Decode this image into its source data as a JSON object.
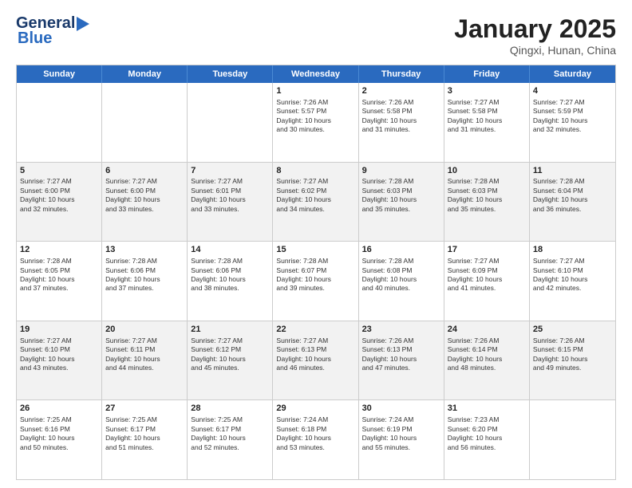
{
  "header": {
    "logo_line1": "General",
    "logo_line2": "Blue",
    "title": "January 2025",
    "subtitle": "Qingxi, Hunan, China"
  },
  "weekdays": [
    "Sunday",
    "Monday",
    "Tuesday",
    "Wednesday",
    "Thursday",
    "Friday",
    "Saturday"
  ],
  "rows": [
    {
      "alt": false,
      "cells": [
        {
          "day": "",
          "lines": []
        },
        {
          "day": "",
          "lines": []
        },
        {
          "day": "",
          "lines": []
        },
        {
          "day": "1",
          "lines": [
            "Sunrise: 7:26 AM",
            "Sunset: 5:57 PM",
            "Daylight: 10 hours",
            "and 30 minutes."
          ]
        },
        {
          "day": "2",
          "lines": [
            "Sunrise: 7:26 AM",
            "Sunset: 5:58 PM",
            "Daylight: 10 hours",
            "and 31 minutes."
          ]
        },
        {
          "day": "3",
          "lines": [
            "Sunrise: 7:27 AM",
            "Sunset: 5:58 PM",
            "Daylight: 10 hours",
            "and 31 minutes."
          ]
        },
        {
          "day": "4",
          "lines": [
            "Sunrise: 7:27 AM",
            "Sunset: 5:59 PM",
            "Daylight: 10 hours",
            "and 32 minutes."
          ]
        }
      ]
    },
    {
      "alt": true,
      "cells": [
        {
          "day": "5",
          "lines": [
            "Sunrise: 7:27 AM",
            "Sunset: 6:00 PM",
            "Daylight: 10 hours",
            "and 32 minutes."
          ]
        },
        {
          "day": "6",
          "lines": [
            "Sunrise: 7:27 AM",
            "Sunset: 6:00 PM",
            "Daylight: 10 hours",
            "and 33 minutes."
          ]
        },
        {
          "day": "7",
          "lines": [
            "Sunrise: 7:27 AM",
            "Sunset: 6:01 PM",
            "Daylight: 10 hours",
            "and 33 minutes."
          ]
        },
        {
          "day": "8",
          "lines": [
            "Sunrise: 7:27 AM",
            "Sunset: 6:02 PM",
            "Daylight: 10 hours",
            "and 34 minutes."
          ]
        },
        {
          "day": "9",
          "lines": [
            "Sunrise: 7:28 AM",
            "Sunset: 6:03 PM",
            "Daylight: 10 hours",
            "and 35 minutes."
          ]
        },
        {
          "day": "10",
          "lines": [
            "Sunrise: 7:28 AM",
            "Sunset: 6:03 PM",
            "Daylight: 10 hours",
            "and 35 minutes."
          ]
        },
        {
          "day": "11",
          "lines": [
            "Sunrise: 7:28 AM",
            "Sunset: 6:04 PM",
            "Daylight: 10 hours",
            "and 36 minutes."
          ]
        }
      ]
    },
    {
      "alt": false,
      "cells": [
        {
          "day": "12",
          "lines": [
            "Sunrise: 7:28 AM",
            "Sunset: 6:05 PM",
            "Daylight: 10 hours",
            "and 37 minutes."
          ]
        },
        {
          "day": "13",
          "lines": [
            "Sunrise: 7:28 AM",
            "Sunset: 6:06 PM",
            "Daylight: 10 hours",
            "and 37 minutes."
          ]
        },
        {
          "day": "14",
          "lines": [
            "Sunrise: 7:28 AM",
            "Sunset: 6:06 PM",
            "Daylight: 10 hours",
            "and 38 minutes."
          ]
        },
        {
          "day": "15",
          "lines": [
            "Sunrise: 7:28 AM",
            "Sunset: 6:07 PM",
            "Daylight: 10 hours",
            "and 39 minutes."
          ]
        },
        {
          "day": "16",
          "lines": [
            "Sunrise: 7:28 AM",
            "Sunset: 6:08 PM",
            "Daylight: 10 hours",
            "and 40 minutes."
          ]
        },
        {
          "day": "17",
          "lines": [
            "Sunrise: 7:27 AM",
            "Sunset: 6:09 PM",
            "Daylight: 10 hours",
            "and 41 minutes."
          ]
        },
        {
          "day": "18",
          "lines": [
            "Sunrise: 7:27 AM",
            "Sunset: 6:10 PM",
            "Daylight: 10 hours",
            "and 42 minutes."
          ]
        }
      ]
    },
    {
      "alt": true,
      "cells": [
        {
          "day": "19",
          "lines": [
            "Sunrise: 7:27 AM",
            "Sunset: 6:10 PM",
            "Daylight: 10 hours",
            "and 43 minutes."
          ]
        },
        {
          "day": "20",
          "lines": [
            "Sunrise: 7:27 AM",
            "Sunset: 6:11 PM",
            "Daylight: 10 hours",
            "and 44 minutes."
          ]
        },
        {
          "day": "21",
          "lines": [
            "Sunrise: 7:27 AM",
            "Sunset: 6:12 PM",
            "Daylight: 10 hours",
            "and 45 minutes."
          ]
        },
        {
          "day": "22",
          "lines": [
            "Sunrise: 7:27 AM",
            "Sunset: 6:13 PM",
            "Daylight: 10 hours",
            "and 46 minutes."
          ]
        },
        {
          "day": "23",
          "lines": [
            "Sunrise: 7:26 AM",
            "Sunset: 6:13 PM",
            "Daylight: 10 hours",
            "and 47 minutes."
          ]
        },
        {
          "day": "24",
          "lines": [
            "Sunrise: 7:26 AM",
            "Sunset: 6:14 PM",
            "Daylight: 10 hours",
            "and 48 minutes."
          ]
        },
        {
          "day": "25",
          "lines": [
            "Sunrise: 7:26 AM",
            "Sunset: 6:15 PM",
            "Daylight: 10 hours",
            "and 49 minutes."
          ]
        }
      ]
    },
    {
      "alt": false,
      "cells": [
        {
          "day": "26",
          "lines": [
            "Sunrise: 7:25 AM",
            "Sunset: 6:16 PM",
            "Daylight: 10 hours",
            "and 50 minutes."
          ]
        },
        {
          "day": "27",
          "lines": [
            "Sunrise: 7:25 AM",
            "Sunset: 6:17 PM",
            "Daylight: 10 hours",
            "and 51 minutes."
          ]
        },
        {
          "day": "28",
          "lines": [
            "Sunrise: 7:25 AM",
            "Sunset: 6:17 PM",
            "Daylight: 10 hours",
            "and 52 minutes."
          ]
        },
        {
          "day": "29",
          "lines": [
            "Sunrise: 7:24 AM",
            "Sunset: 6:18 PM",
            "Daylight: 10 hours",
            "and 53 minutes."
          ]
        },
        {
          "day": "30",
          "lines": [
            "Sunrise: 7:24 AM",
            "Sunset: 6:19 PM",
            "Daylight: 10 hours",
            "and 55 minutes."
          ]
        },
        {
          "day": "31",
          "lines": [
            "Sunrise: 7:23 AM",
            "Sunset: 6:20 PM",
            "Daylight: 10 hours",
            "and 56 minutes."
          ]
        },
        {
          "day": "",
          "lines": []
        }
      ]
    }
  ]
}
